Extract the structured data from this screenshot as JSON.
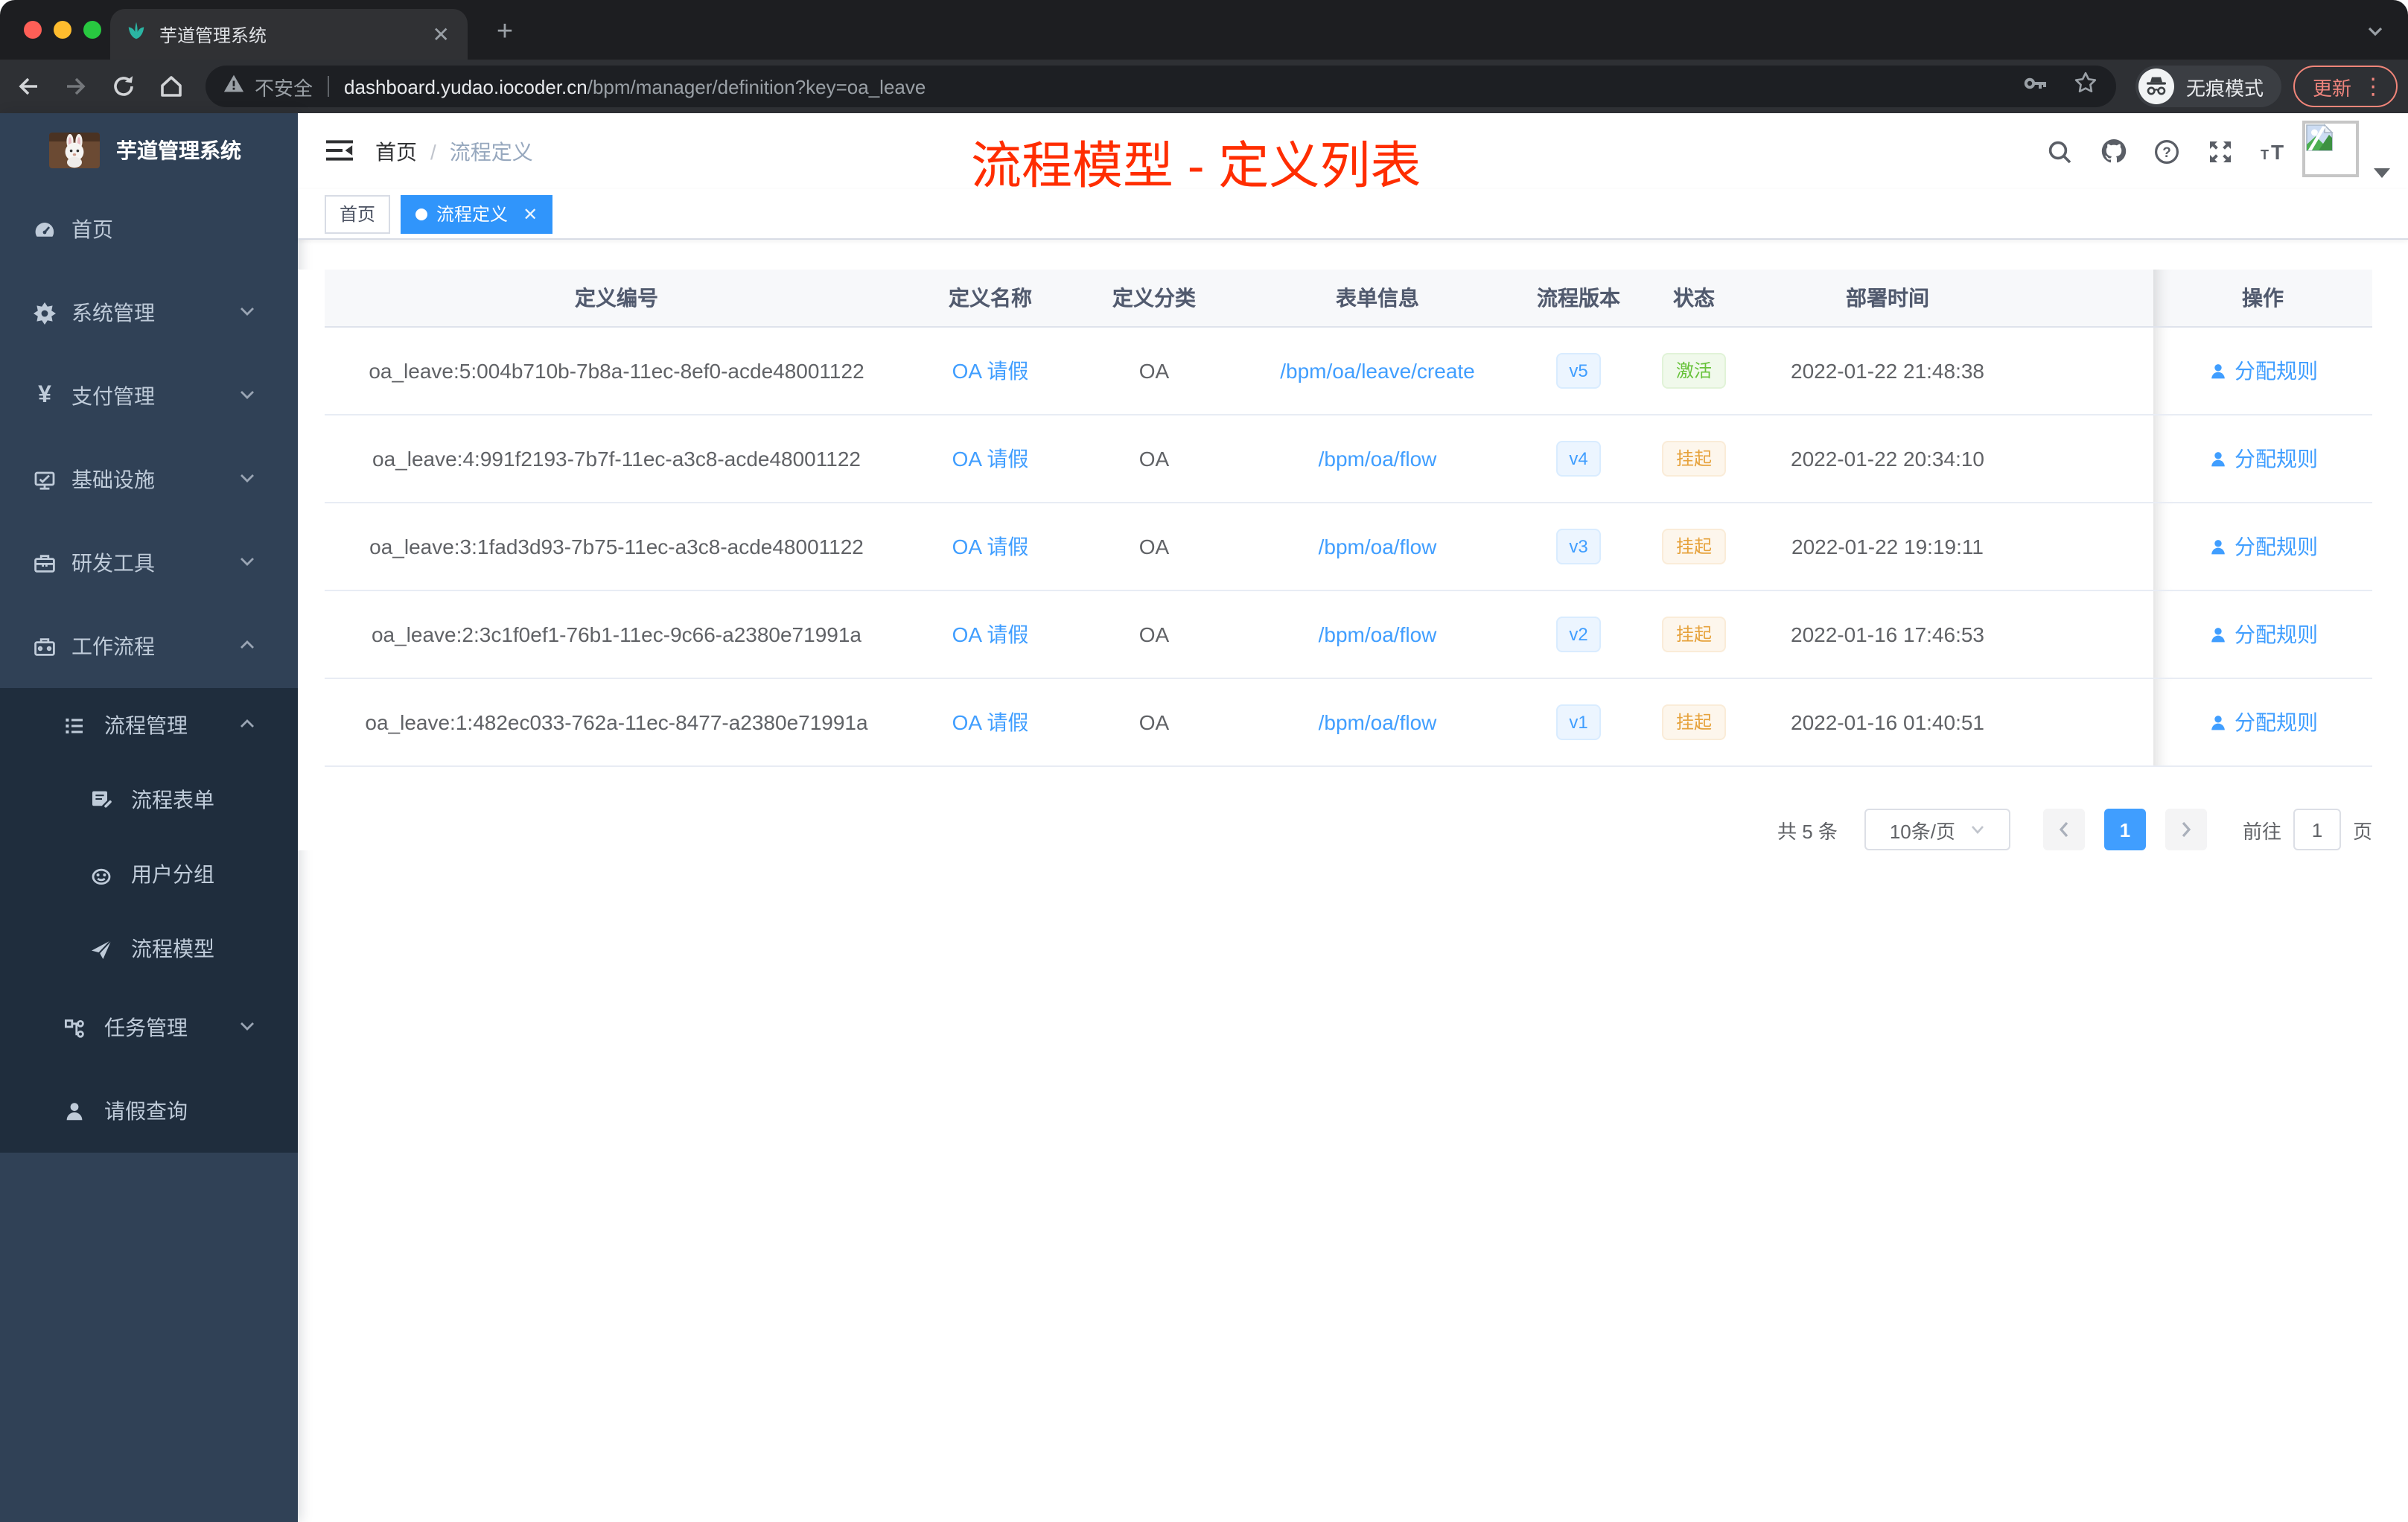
{
  "colors": {
    "accent": "#409eff",
    "annotation_red": "#ff2d00",
    "status_active_green": "#67c23a",
    "status_suspend_orange": "#e6a23c",
    "sidebar_bg": "#304156",
    "sidebar_sub_bg": "#1f2d3d"
  },
  "browser": {
    "tab": {
      "title": "芋道管理系统"
    },
    "address": {
      "security_label": "不安全",
      "domain": "dashboard.yudao.iocoder.cn",
      "path": "/bpm/manager/definition?key=oa_leave"
    },
    "incognito_label": "无痕模式",
    "update_button": "更新"
  },
  "sidebar": {
    "app_title": "芋道管理系统",
    "items": [
      {
        "label": "首页",
        "icon": "dashboard-icon"
      },
      {
        "label": "系统管理",
        "icon": "gear-icon"
      },
      {
        "label": "支付管理",
        "icon": "yen-icon"
      },
      {
        "label": "基础设施",
        "icon": "monitor-icon"
      },
      {
        "label": "研发工具",
        "icon": "toolbox-icon"
      },
      {
        "label": "工作流程",
        "icon": "briefcase-icon"
      },
      {
        "label": "流程管理",
        "icon": "list-tree-icon"
      },
      {
        "label": "流程表单",
        "icon": "form-edit-icon"
      },
      {
        "label": "用户分组",
        "icon": "robot-icon"
      },
      {
        "label": "流程模型",
        "icon": "paper-plane-icon"
      },
      {
        "label": "任务管理",
        "icon": "org-tree-icon"
      },
      {
        "label": "请假查询",
        "icon": "user-icon"
      }
    ]
  },
  "header": {
    "breadcrumb": {
      "home": "首页",
      "separator": "/",
      "current": "流程定义"
    },
    "annotation": "流程模型 - 定义列表"
  },
  "tags": {
    "home": "首页",
    "active": "流程定义"
  },
  "table": {
    "columns": [
      "定义编号",
      "定义名称",
      "定义分类",
      "表单信息",
      "流程版本",
      "状态",
      "部署时间",
      "操作"
    ],
    "rows": [
      {
        "id": "oa_leave:5:004b710b-7b8a-11ec-8ef0-acde48001122",
        "name": "OA 请假",
        "category": "OA",
        "form": "/bpm/oa/leave/create",
        "version": "v5",
        "status": "激活",
        "status_type": "success",
        "deployed": "2022-01-22 21:48:38",
        "action": "分配规则"
      },
      {
        "id": "oa_leave:4:991f2193-7b7f-11ec-a3c8-acde48001122",
        "name": "OA 请假",
        "category": "OA",
        "form": "/bpm/oa/flow",
        "version": "v4",
        "status": "挂起",
        "status_type": "warning",
        "deployed": "2022-01-22 20:34:10",
        "action": "分配规则"
      },
      {
        "id": "oa_leave:3:1fad3d93-7b75-11ec-a3c8-acde48001122",
        "name": "OA 请假",
        "category": "OA",
        "form": "/bpm/oa/flow",
        "version": "v3",
        "status": "挂起",
        "status_type": "warning",
        "deployed": "2022-01-22 19:19:11",
        "action": "分配规则"
      },
      {
        "id": "oa_leave:2:3c1f0ef1-76b1-11ec-9c66-a2380e71991a",
        "name": "OA 请假",
        "category": "OA",
        "form": "/bpm/oa/flow",
        "version": "v2",
        "status": "挂起",
        "status_type": "warning",
        "deployed": "2022-01-16 17:46:53",
        "action": "分配规则"
      },
      {
        "id": "oa_leave:1:482ec033-762a-11ec-8477-a2380e71991a",
        "name": "OA 请假",
        "category": "OA",
        "form": "/bpm/oa/flow",
        "version": "v1",
        "status": "挂起",
        "status_type": "warning",
        "deployed": "2022-01-16 01:40:51",
        "action": "分配规则"
      }
    ]
  },
  "pagination": {
    "total": "共 5 条",
    "page_size": "10条/页",
    "current_page": "1",
    "goto_label": "前往",
    "goto_value": "1",
    "page_unit": "页"
  }
}
